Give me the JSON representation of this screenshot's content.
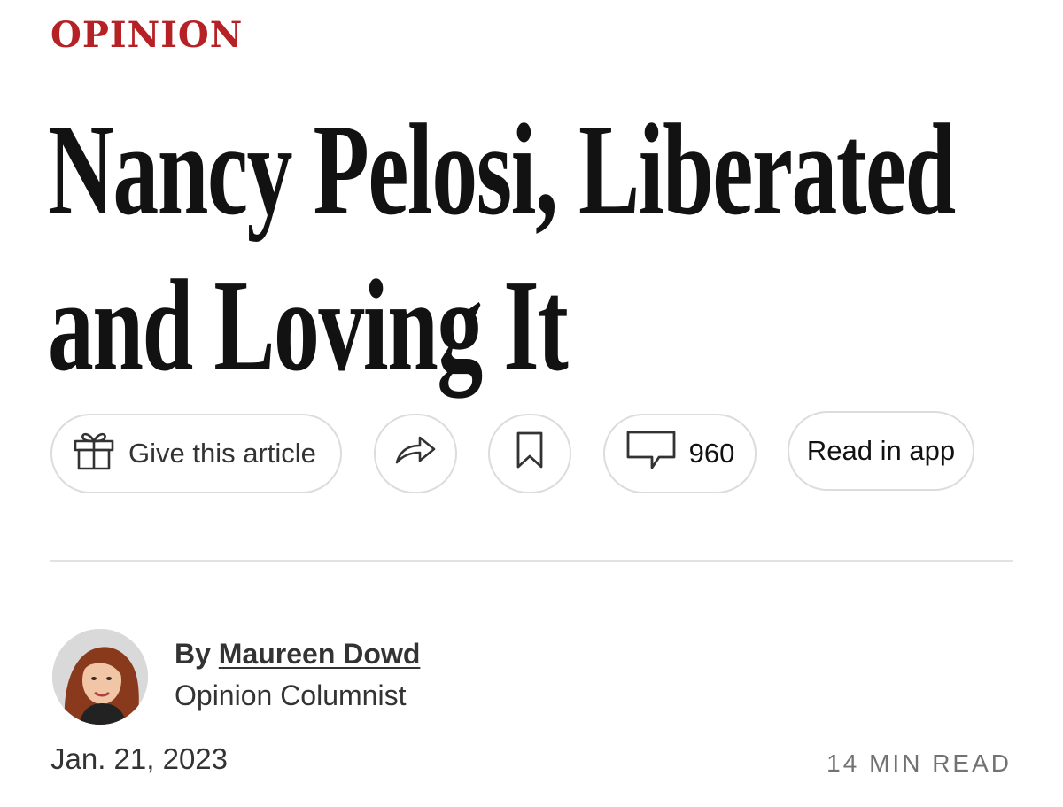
{
  "section": {
    "kicker": "OPINION",
    "kicker_color": "#b62125"
  },
  "article": {
    "headline_line1": "Nancy Pelosi, Liberated",
    "headline_line2": "and Loving It"
  },
  "toolbar": {
    "gift_label": "Give this article",
    "gift_icon": "gift-icon",
    "share_icon": "share-arrow-icon",
    "save_icon": "bookmark-icon",
    "comments_icon": "comment-bubble-icon",
    "comments_count": "960",
    "app_label": "Read in app"
  },
  "byline": {
    "prefix": "By",
    "author": "Maureen Dowd",
    "role": "Opinion Columnist"
  },
  "meta": {
    "date": "Jan. 21, 2023",
    "read_time": "14 MIN READ"
  }
}
